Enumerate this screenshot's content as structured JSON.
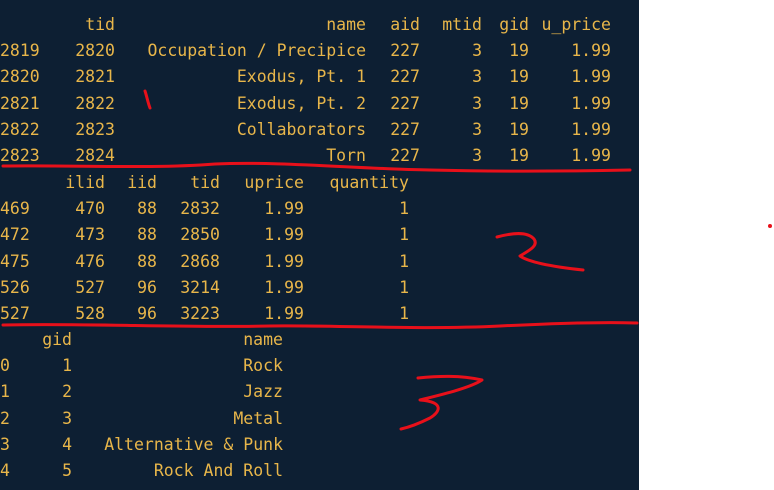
{
  "colors": {
    "background": "#0d1f33",
    "text": "#e8b64a",
    "annotation": "#e8101a",
    "page": "#ffffff"
  },
  "frames": [
    {
      "columns": [
        "",
        "tid",
        "name",
        "aid",
        "mtid",
        "gid",
        "u_price"
      ],
      "rows": [
        [
          "2819",
          "2820",
          "Occupation / Precipice",
          "227",
          "3",
          "19",
          "1.99"
        ],
        [
          "2820",
          "2821",
          "Exodus, Pt. 1",
          "227",
          "3",
          "19",
          "1.99"
        ],
        [
          "2821",
          "2822",
          "Exodus, Pt. 2",
          "227",
          "3",
          "19",
          "1.99"
        ],
        [
          "2822",
          "2823",
          "Collaborators",
          "227",
          "3",
          "19",
          "1.99"
        ],
        [
          "2823",
          "2824",
          "Torn",
          "227",
          "3",
          "19",
          "1.99"
        ]
      ]
    },
    {
      "columns": [
        "",
        "ilid",
        "iid",
        "tid",
        "uprice",
        "quantity"
      ],
      "rows": [
        [
          "469",
          "470",
          "88",
          "2832",
          "1.99",
          "1"
        ],
        [
          "472",
          "473",
          "88",
          "2850",
          "1.99",
          "1"
        ],
        [
          "475",
          "476",
          "88",
          "2868",
          "1.99",
          "1"
        ],
        [
          "526",
          "527",
          "96",
          "3214",
          "1.99",
          "1"
        ],
        [
          "527",
          "528",
          "96",
          "3223",
          "1.99",
          "1"
        ]
      ]
    },
    {
      "columns": [
        "",
        "gid",
        "name"
      ],
      "rows": [
        [
          "0",
          "1",
          "Rock"
        ],
        [
          "1",
          "2",
          "Jazz"
        ],
        [
          "2",
          "3",
          "Metal"
        ],
        [
          "3",
          "4",
          "Alternative & Punk"
        ],
        [
          "4",
          "5",
          "Rock And Roll"
        ]
      ]
    }
  ]
}
